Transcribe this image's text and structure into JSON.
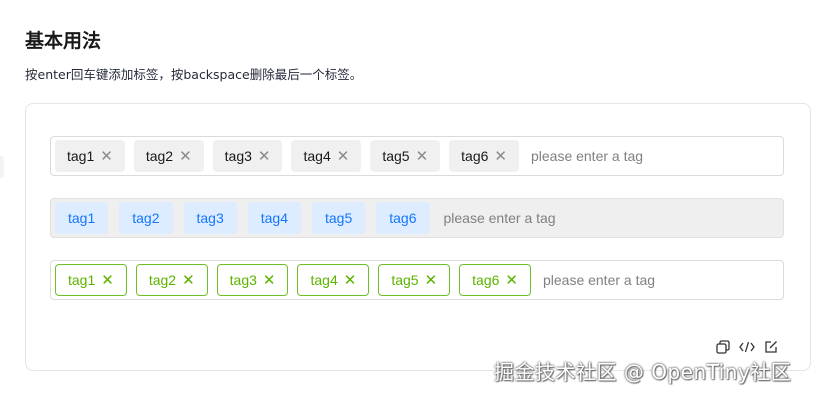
{
  "section": {
    "title": "基本用法",
    "description": "按enter回车键添加标签，按backspace删除最后一个标签。"
  },
  "inputs": [
    {
      "variant": "default",
      "tags": [
        "tag1",
        "tag2",
        "tag3",
        "tag4",
        "tag5",
        "tag6"
      ],
      "placeholder": "please enter a tag",
      "closable": true
    },
    {
      "variant": "disabled",
      "tags": [
        "tag1",
        "tag2",
        "tag3",
        "tag4",
        "tag5",
        "tag6"
      ],
      "placeholder": "please enter a tag",
      "closable": false
    },
    {
      "variant": "success-outline",
      "tags": [
        "tag1",
        "tag2",
        "tag3",
        "tag4",
        "tag5",
        "tag6"
      ],
      "placeholder": "please enter a tag",
      "closable": true
    }
  ],
  "close_glyph": "✕",
  "toolbar": {
    "icons": [
      "copy-icon",
      "code-icon",
      "edit-icon"
    ]
  },
  "colors": {
    "accent_blue": "#1476ff",
    "success_green": "#5cb300",
    "tag_gray": "#f0f0f0"
  },
  "watermark": "掘金技术社区 @ OpenTiny社区"
}
